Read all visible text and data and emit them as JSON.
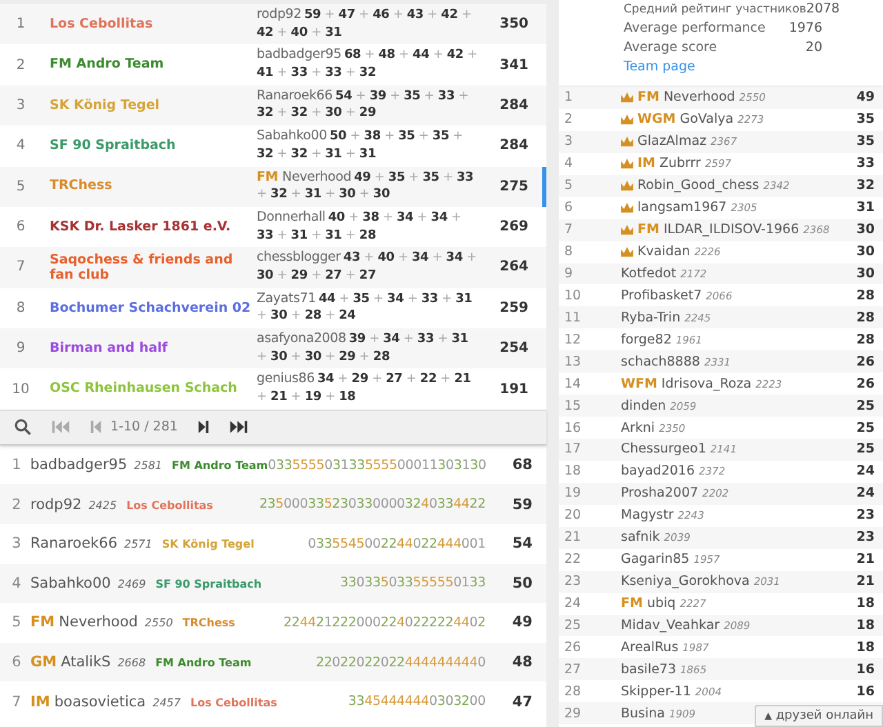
{
  "teams": [
    {
      "rank": "1",
      "name": "Los Cebollitas",
      "color": "#e0735a",
      "leader": "rodp92",
      "scores": "**59** + **47** + **46** + **43** + **42** + **42** + **40** + **31**",
      "total": "350",
      "selected": false
    },
    {
      "rank": "2",
      "name": "FM Andro Team",
      "color": "#3d8b2f",
      "leader": "badbadger95",
      "scores": "**68** + **48** + **44** + **42** + **41** + **33** + **33** + **32**",
      "total": "341",
      "selected": false
    },
    {
      "rank": "3",
      "name": "SK König Tegel",
      "color": "#d4a437",
      "leader": "Ranaroek66",
      "scores": "**54** + **39** + **35** + **33** + **32** + **32** + **30** + **29**",
      "total": "284",
      "selected": false
    },
    {
      "rank": "4",
      "name": "SF 90 Spraitbach",
      "color": "#3a9a6a",
      "leader": "Sabahko00",
      "scores": "**50** + **38** + **35** + **35** + **32** + **32** + **31** + **31**",
      "total": "284",
      "selected": false
    },
    {
      "rank": "5",
      "name": "TRChess",
      "color": "#d98b2b",
      "title": "FM",
      "leader": "Neverhood",
      "scores": "**49** + **35** + **35** + **33** + **32** + **31** + **30** + **30**",
      "total": "275",
      "selected": true
    },
    {
      "rank": "6",
      "name": "KSK Dr. Lasker 1861 e.V.",
      "color": "#a83232",
      "leader": "Donnerhall",
      "scores": "**40** + **38** + **34** + **34** + **33** + **31** + **31** + **28**",
      "total": "269",
      "selected": false
    },
    {
      "rank": "7",
      "name": "Saqochess & friends and fan club",
      "color": "#e8602c",
      "leader": "chessblogger",
      "scores": "**43** + **40** + **34** + **34** + **30** + **29** + **27** + **27**",
      "total": "264",
      "selected": false
    },
    {
      "rank": "8",
      "name": "Bochumer Schachverein 02",
      "color": "#5b6ee0",
      "leader": "Zayats71",
      "scores": "**44** + **35** + **34** + **33** + **31** + **30** + **28** + **24**",
      "total": "259",
      "selected": false
    },
    {
      "rank": "9",
      "name": "Birman and half",
      "color": "#9b4be0",
      "leader": "asafyona2008",
      "scores": "**39** + **34** + **33** + **31** + **30** + **30** + **29** + **28**",
      "total": "254",
      "selected": false
    },
    {
      "rank": "10",
      "name": "OSC Rheinhausen Schach",
      "color": "#8cc43c",
      "leader": "genius86",
      "scores": "**34** + **29** + **27** + **22** + **21** + **21** + **19** + **18**",
      "total": "191",
      "selected": false
    }
  ],
  "pager": {
    "buttons": [
      {
        "kind": "first",
        "disabled": true
      },
      {
        "kind": "prev",
        "disabled": true
      },
      {
        "kind": "next",
        "disabled": false
      },
      {
        "kind": "last",
        "disabled": false
      }
    ],
    "range": "1-10 / 281"
  },
  "players": [
    {
      "rank": "1",
      "name": "badbadger95",
      "rating": "2581",
      "team": "FM Andro Team",
      "color": "#3d8b2f",
      "sheet": "033555503133555500011303130",
      "score": "68"
    },
    {
      "rank": "2",
      "name": "rodp92",
      "rating": "2425",
      "team": "Los Cebollitas",
      "color": "#e0735a",
      "sheet": "2350003352303300003240334422",
      "score": "59"
    },
    {
      "rank": "3",
      "name": "Ranaroek66",
      "rating": "2571",
      "team": "SK König Tegel",
      "color": "#d4a437",
      "sheet": "0335545002244022444001",
      "score": "54"
    },
    {
      "rank": "4",
      "name": "Sabahko00",
      "rating": "2469",
      "team": "SF 90 Spraitbach",
      "color": "#3a9a6a",
      "sheet": "330335033555550133",
      "score": "50"
    },
    {
      "rank": "5",
      "title": "FM",
      "name": "Neverhood",
      "rating": "2550",
      "team": "TRChess",
      "color": "#d98b2b",
      "sheet": "2244212220002240222224402",
      "score": "49"
    },
    {
      "rank": "6",
      "title": "GM",
      "name": "AtalikS",
      "rating": "2668",
      "team": "FM Andro Team",
      "color": "#3d8b2f",
      "sheet": "220220220224444444440",
      "score": "48"
    },
    {
      "rank": "7",
      "title": "IM",
      "name": "boasovietica",
      "rating": "2457",
      "team": "Los Cebollitas",
      "color": "#e0735a",
      "sheet": "33454444440303200",
      "score": "47"
    }
  ],
  "team_info": {
    "stats": [
      {
        "label": "Средний рейтинг участников",
        "value": "2078"
      },
      {
        "label": "Average performance",
        "value": "1976"
      },
      {
        "label": "Average score",
        "value": "20"
      }
    ],
    "link": "Team page"
  },
  "members": [
    {
      "rank": "1",
      "crown": true,
      "title": "FM",
      "name": "Neverhood",
      "rating": "2550",
      "score": "49"
    },
    {
      "rank": "2",
      "crown": true,
      "title": "WGM",
      "name": "GoValya",
      "rating": "2273",
      "score": "35"
    },
    {
      "rank": "3",
      "crown": true,
      "name": "GlazAlmaz",
      "rating": "2367",
      "score": "35"
    },
    {
      "rank": "4",
      "crown": true,
      "title": "IM",
      "name": "Zubrrr",
      "rating": "2597",
      "score": "33"
    },
    {
      "rank": "5",
      "crown": true,
      "name": "Robin_Good_chess",
      "rating": "2342",
      "score": "32"
    },
    {
      "rank": "6",
      "crown": true,
      "name": "langsam1967",
      "rating": "2305",
      "score": "31"
    },
    {
      "rank": "7",
      "crown": true,
      "title": "FM",
      "name": "ILDAR_ILDISOV-1966",
      "rating": "2368",
      "score": "30"
    },
    {
      "rank": "8",
      "crown": true,
      "name": "Kvaidan",
      "rating": "2226",
      "score": "30"
    },
    {
      "rank": "9",
      "crown": false,
      "name": "Kotfedot",
      "rating": "2172",
      "score": "30"
    },
    {
      "rank": "10",
      "crown": false,
      "name": "Profibasket7",
      "rating": "2066",
      "score": "28"
    },
    {
      "rank": "11",
      "crown": false,
      "name": "Ryba-Trin",
      "rating": "2245",
      "score": "28"
    },
    {
      "rank": "12",
      "crown": false,
      "name": "forge82",
      "rating": "1961",
      "score": "28"
    },
    {
      "rank": "13",
      "crown": false,
      "name": "schach8888",
      "rating": "2331",
      "score": "26"
    },
    {
      "rank": "14",
      "crown": false,
      "title": "WFM",
      "name": "Idrisova_Roza",
      "rating": "2223",
      "score": "26"
    },
    {
      "rank": "15",
      "crown": false,
      "name": "dinden",
      "rating": "2059",
      "score": "25"
    },
    {
      "rank": "16",
      "crown": false,
      "name": "Arkni",
      "rating": "2350",
      "score": "25"
    },
    {
      "rank": "17",
      "crown": false,
      "name": "Chessurgeo1",
      "rating": "2141",
      "score": "25"
    },
    {
      "rank": "18",
      "crown": false,
      "name": "bayad2016",
      "rating": "2372",
      "score": "24"
    },
    {
      "rank": "19",
      "crown": false,
      "name": "Prosha2007",
      "rating": "2202",
      "score": "24"
    },
    {
      "rank": "20",
      "crown": false,
      "name": "Magystr",
      "rating": "2243",
      "score": "23"
    },
    {
      "rank": "21",
      "crown": false,
      "name": "safnik",
      "rating": "2039",
      "score": "23"
    },
    {
      "rank": "22",
      "crown": false,
      "name": "Gagarin85",
      "rating": "1957",
      "score": "21"
    },
    {
      "rank": "23",
      "crown": false,
      "name": "Kseniya_Gorokhova",
      "rating": "2031",
      "score": "21"
    },
    {
      "rank": "24",
      "crown": false,
      "title": "FM",
      "name": "ubiq",
      "rating": "2227",
      "score": "18"
    },
    {
      "rank": "25",
      "crown": false,
      "name": "Midav_Veahkar",
      "rating": "2089",
      "score": "18"
    },
    {
      "rank": "26",
      "crown": false,
      "name": "ArealRus",
      "rating": "1987",
      "score": "18"
    },
    {
      "rank": "27",
      "crown": false,
      "name": "basile73",
      "rating": "1865",
      "score": "16"
    },
    {
      "rank": "28",
      "crown": false,
      "name": "Skipper-11",
      "rating": "2004",
      "score": "16"
    },
    {
      "rank": "29",
      "crown": false,
      "name": "Busina",
      "rating": "1909"
    }
  ],
  "friends_button": {
    "arrow": "▲",
    "label": "друзей онлайн"
  }
}
